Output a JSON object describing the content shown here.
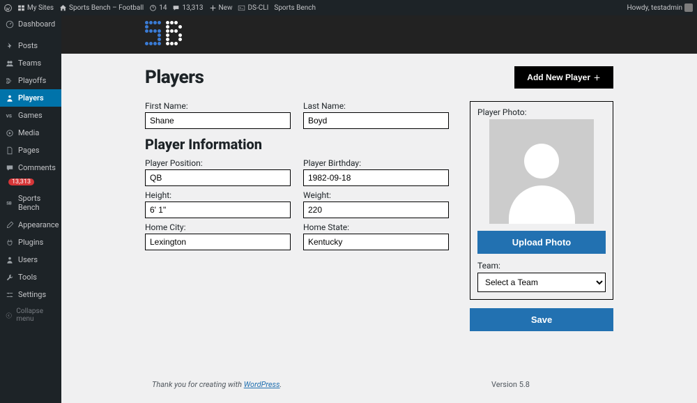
{
  "adminbar": {
    "mysites": "My Sites",
    "site": "Sports Bench – Football",
    "updates": "14",
    "comments": "13,313",
    "new": "New",
    "dscli": "DS-CLI",
    "sportsbench": "Sports Bench",
    "howdy": "Howdy, testadmin"
  },
  "sidebar": {
    "dashboard": "Dashboard",
    "posts": "Posts",
    "teams": "Teams",
    "playoffs": "Playoffs",
    "players": "Players",
    "games": "Games",
    "media": "Media",
    "pages": "Pages",
    "comments": "Comments",
    "comments_badge": "13,313",
    "sportsbench": "Sports Bench",
    "appearance": "Appearance",
    "plugins": "Plugins",
    "users": "Users",
    "tools": "Tools",
    "settings": "Settings",
    "collapse": "Collapse menu"
  },
  "page": {
    "title": "Players",
    "add_button": "Add New Player",
    "section_title": "Player Information"
  },
  "labels": {
    "first_name": "First Name:",
    "last_name": "Last Name:",
    "position": "Player Position:",
    "birthday": "Player Birthday:",
    "height": "Height:",
    "weight": "Weight:",
    "home_city": "Home City:",
    "home_state": "Home State:",
    "photo": "Player Photo:",
    "team": "Team:"
  },
  "values": {
    "first_name": "Shane",
    "last_name": "Boyd",
    "position": "QB",
    "birthday": "1982-09-18",
    "height": "6' 1\"",
    "weight": "220",
    "home_city": "Lexington",
    "home_state": "Kentucky",
    "team": "Select a Team"
  },
  "buttons": {
    "upload": "Upload Photo",
    "save": "Save"
  },
  "footer": {
    "thanks_prefix": "Thank you for creating with ",
    "wp": "WordPress",
    "thanks_suffix": ".",
    "version": "Version 5.8"
  }
}
